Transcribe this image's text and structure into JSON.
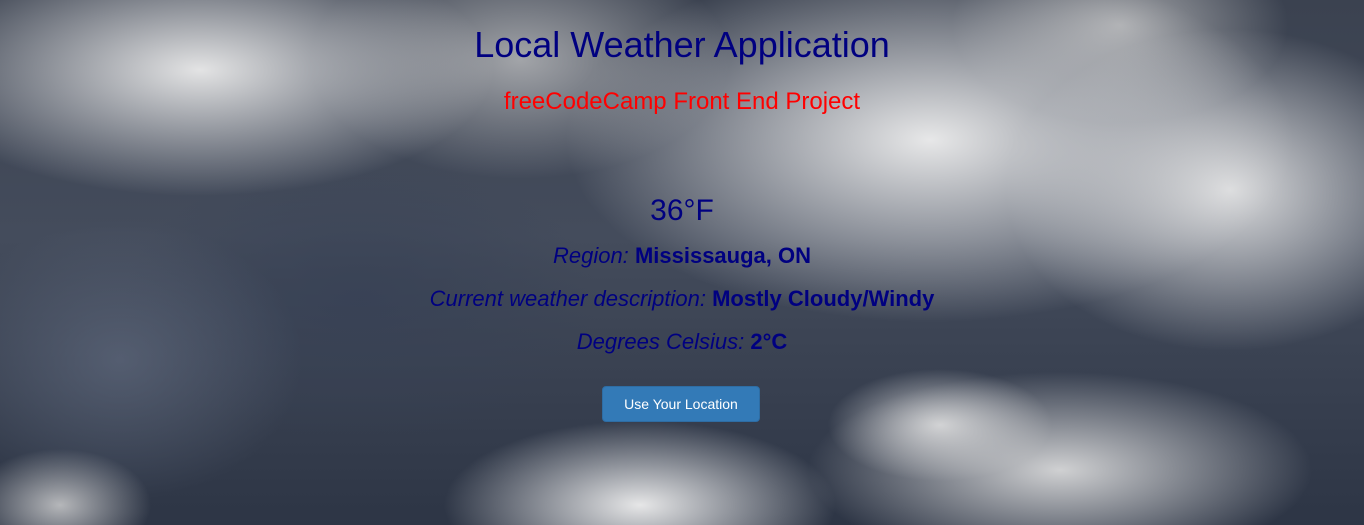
{
  "page": {
    "title": "Local Weather Application",
    "subtitle": "freeCodeCamp Front End Project"
  },
  "weather": {
    "temperature_f": "36°F",
    "region_label": "Region:",
    "region_value": "Mississauga, ON",
    "description_label": "Current weather description:",
    "description_value": "Mostly Cloudy/Windy",
    "celsius_label": "Degrees Celsius:",
    "celsius_value": "2°C"
  },
  "actions": {
    "location_button_label": "Use Your Location"
  },
  "colors": {
    "title": "#000080",
    "subtitle": "#ff0000",
    "text": "#000080",
    "button_bg": "#337ab7",
    "button_text": "#ffffff"
  }
}
